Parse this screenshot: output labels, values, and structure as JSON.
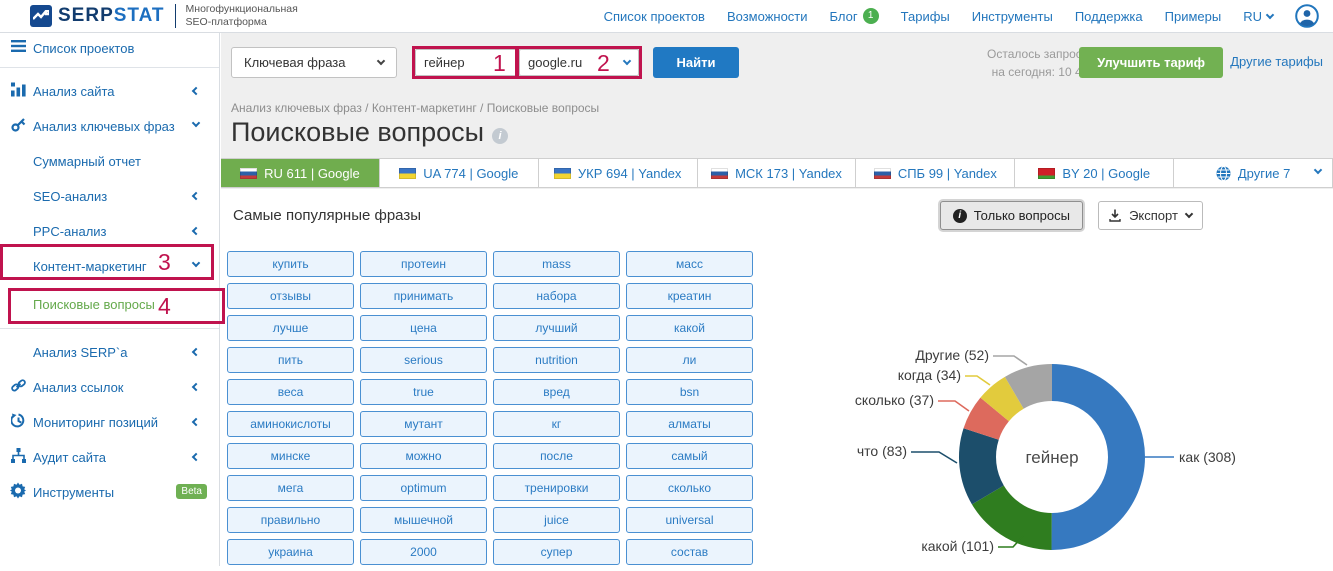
{
  "header": {
    "logo": {
      "serp": "SERP",
      "stat": "STAT"
    },
    "tagline_line1": "Многофункциональная",
    "tagline_line2": "SEO-платформа",
    "nav": [
      {
        "label": "Список проектов"
      },
      {
        "label": "Возможности"
      },
      {
        "label": "Блог",
        "badge": "1"
      },
      {
        "label": "Тарифы"
      },
      {
        "label": "Инструменты"
      },
      {
        "label": "Поддержка"
      },
      {
        "label": "Примеры"
      }
    ],
    "lang": "RU"
  },
  "sidebar": {
    "items": [
      {
        "label": "Список проектов"
      },
      {
        "label": "Анализ сайта"
      },
      {
        "label": "Анализ ключевых фраз"
      },
      {
        "label": "Суммарный отчет"
      },
      {
        "label": "SEO-анализ"
      },
      {
        "label": "PPC-анализ"
      },
      {
        "label": "Контент-маркетинг"
      },
      {
        "label": "Поисковые вопросы"
      },
      {
        "label": "Анализ SERP`a"
      },
      {
        "label": "Анализ ссылок"
      },
      {
        "label": "Мониторинг позиций"
      },
      {
        "label": "Аудит сайта"
      },
      {
        "label": "Инструменты",
        "badge": "Beta"
      }
    ]
  },
  "toolbar": {
    "search_type": "Ключевая фраза",
    "query_value": "гейнер",
    "region_value": "google.ru",
    "search_button": "Найти",
    "quota_line1": "Осталось запросов",
    "quota_line2": "на сегодня: 10 494",
    "upgrade_button": "Улучшить тариф",
    "other_plans_link": "Другие тарифы"
  },
  "annotations": {
    "n1": "1",
    "n2": "2",
    "n3": "3",
    "n4": "4"
  },
  "breadcrumb": "Анализ ключевых фраз / Контент-маркетинг / Поисковые вопросы",
  "page_title": "Поисковые вопросы",
  "tabs": [
    {
      "label": "RU 611 | Google",
      "flag": "ru",
      "active": true
    },
    {
      "label": "UA 774 | Google",
      "flag": "ua",
      "active": false
    },
    {
      "label": "УКР 694 | Yandex",
      "flag": "ua",
      "active": false
    },
    {
      "label": "МСК 173 | Yandex",
      "flag": "ru",
      "active": false
    },
    {
      "label": "СПБ 99 | Yandex",
      "flag": "ru",
      "active": false
    },
    {
      "label": "BY 20 | Google",
      "flag": "by",
      "active": false
    },
    {
      "label": "Другие 7",
      "flag": "globe",
      "active": false
    }
  ],
  "panel": {
    "title": "Самые популярные фразы",
    "only_questions_button": "Только вопросы",
    "export_button": "Экспорт"
  },
  "keywords": [
    "купить",
    "протеин",
    "mass",
    "масс",
    "отзывы",
    "принимать",
    "набора",
    "креатин",
    "лучше",
    "цена",
    "лучший",
    "какой",
    "пить",
    "serious",
    "nutrition",
    "ли",
    "веса",
    "true",
    "вред",
    "bsn",
    "аминокислоты",
    "мутант",
    "кг",
    "алматы",
    "минске",
    "можно",
    "после",
    "самый",
    "мега",
    "optimum",
    "тренировки",
    "сколько",
    "правильно",
    "мышечной",
    "juice",
    "universal",
    "украина",
    "2000",
    "супер",
    "состав"
  ],
  "chart_data": {
    "type": "pie",
    "subtype": "donut",
    "center_label": "гейнер",
    "donut_hole": 0.6,
    "start_angle_deg": 0,
    "direction": "clockwise",
    "total": 615,
    "slices": [
      {
        "name": "как",
        "value": 308,
        "color": "#3679c0",
        "label": "как (308)"
      },
      {
        "name": "какой",
        "value": 101,
        "color": "#2f7d1f",
        "label": "какой (101)"
      },
      {
        "name": "что",
        "value": 83,
        "color": "#1c4e6b",
        "label": "что (83)"
      },
      {
        "name": "сколько",
        "value": 37,
        "color": "#dd6a5d",
        "label": "сколько (37)"
      },
      {
        "name": "когда",
        "value": 34,
        "color": "#e2cb3d",
        "label": "когда (34)"
      },
      {
        "name": "Другие",
        "value": 52,
        "color": "#a5a5a5",
        "label": "Другие (52)"
      }
    ]
  }
}
